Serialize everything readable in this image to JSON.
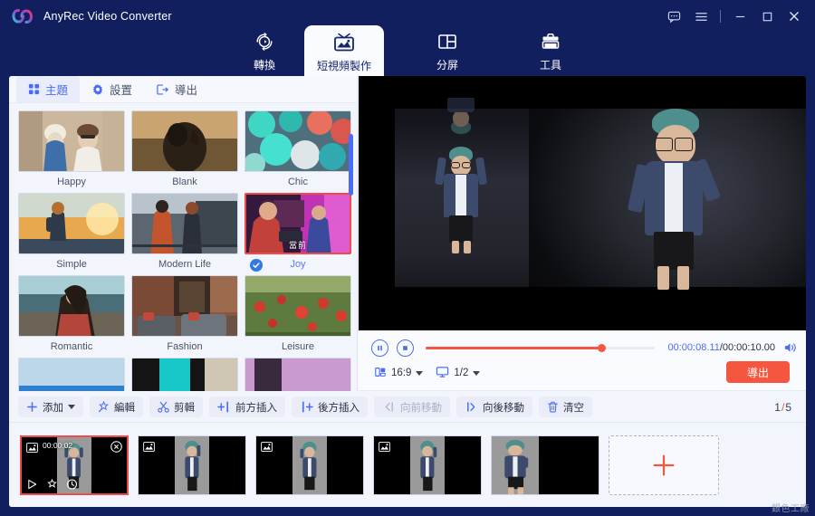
{
  "app": {
    "title": "AnyRec Video Converter",
    "logo_icon": "infinity-link-logo"
  },
  "titlebar": {
    "feedback_icon": "chat-bubble-icon",
    "menu_icon": "hamburger-menu-icon",
    "minimize_icon": "minimize-icon",
    "maximize_icon": "maximize-icon",
    "close_icon": "close-icon"
  },
  "nav": {
    "tabs": [
      {
        "label": "轉換",
        "icon": "convert-circle-icon",
        "active": false
      },
      {
        "label": "短視頻製作",
        "icon": "mv-picture-icon",
        "active": true
      },
      {
        "label": "分屏",
        "icon": "split-screen-icon",
        "active": false
      },
      {
        "label": "工具",
        "icon": "toolbox-icon",
        "active": false
      }
    ]
  },
  "panel": {
    "tabs": [
      {
        "label": "主題",
        "icon": "grid-dots-icon",
        "active": true
      },
      {
        "label": "設置",
        "icon": "gear-icon",
        "active": false
      },
      {
        "label": "導出",
        "icon": "export-arrow-icon",
        "active": false
      }
    ],
    "themes": [
      {
        "label": "Happy",
        "selected": false
      },
      {
        "label": "Blank",
        "selected": false
      },
      {
        "label": "Chic",
        "selected": false
      },
      {
        "label": "Simple",
        "selected": false
      },
      {
        "label": "Modern Life",
        "selected": false
      },
      {
        "label": "Joy",
        "selected": true,
        "badge": "當前"
      },
      {
        "label": "Romantic",
        "selected": false
      },
      {
        "label": "Fashion",
        "selected": false
      },
      {
        "label": "Leisure",
        "selected": false
      }
    ]
  },
  "player": {
    "pause_icon": "pause-icon",
    "stop_icon": "stop-icon",
    "current_time": "00:00:08.11",
    "separator": "/",
    "total_time": "00:00:10.00",
    "volume_icon": "speaker-icon",
    "progress_percent": 77,
    "aspect_ratio": {
      "value": "16:9",
      "icon": "aspect-ratio-icon"
    },
    "split_mode": {
      "value": "1/2",
      "icon": "monitor-icon"
    },
    "export_label": "導出"
  },
  "toolbar": {
    "buttons": [
      {
        "label": "添加",
        "icon": "plus-icon",
        "disabled": false,
        "has_caret": true
      },
      {
        "label": "編輯",
        "icon": "magic-wand-icon",
        "disabled": false,
        "has_caret": false
      },
      {
        "label": "剪輯",
        "icon": "scissors-icon",
        "disabled": false,
        "has_caret": false
      },
      {
        "label": "前方插入",
        "icon": "insert-before-icon",
        "disabled": false,
        "has_caret": false
      },
      {
        "label": "後方插入",
        "icon": "insert-after-icon",
        "disabled": false,
        "has_caret": false
      },
      {
        "label": "向前移動",
        "icon": "move-back-icon",
        "disabled": true,
        "has_caret": false
      },
      {
        "label": "向後移動",
        "icon": "move-forward-icon",
        "disabled": false,
        "has_caret": false
      },
      {
        "label": "清空",
        "icon": "trash-icon",
        "disabled": false,
        "has_caret": false
      }
    ],
    "page_current": "1",
    "page_separator": "/",
    "page_total": "5"
  },
  "storyboard": {
    "clips": [
      {
        "selected": true,
        "time": "00:00:02",
        "image_icon": "image-placeholder-icon",
        "close_icon": "close-circle-icon",
        "tools": [
          "play-icon",
          "effects-star-icon",
          "clock-icon"
        ]
      },
      {
        "selected": false,
        "image_icon": "image-placeholder-icon"
      },
      {
        "selected": false,
        "image_icon": "image-placeholder-icon"
      },
      {
        "selected": false,
        "image_icon": "image-placeholder-icon"
      },
      {
        "selected": false,
        "image_icon": "image-placeholder-icon"
      }
    ],
    "add_clip_icon": "plus-icon"
  },
  "watermark": {
    "text": "銀色工廠"
  },
  "colors": {
    "window_blue": "#111f5e",
    "accent_blue": "#4a6cf7",
    "accent_red": "#f4563f",
    "selected_red": "#f04b4b",
    "panel_bg": "#f3f5fc"
  }
}
